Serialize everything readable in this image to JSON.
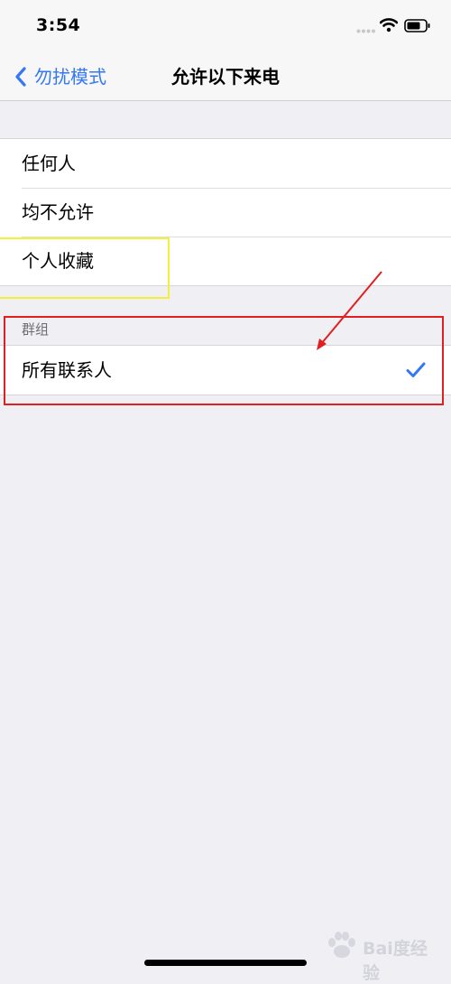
{
  "status_bar": {
    "time": "3:54"
  },
  "nav": {
    "back_label": "勿扰模式",
    "title": "允许以下来电"
  },
  "options": [
    {
      "label": "任何人"
    },
    {
      "label": "均不允许"
    },
    {
      "label": "个人收藏"
    }
  ],
  "groups_section": {
    "header": "群组",
    "items": [
      {
        "label": "所有联系人",
        "selected": true
      }
    ]
  },
  "colors": {
    "accent": "#3478f6",
    "annotation_red": "#e02020",
    "annotation_yellow": "#f4f03a"
  },
  "watermark": {
    "text": "Bai度经验"
  }
}
